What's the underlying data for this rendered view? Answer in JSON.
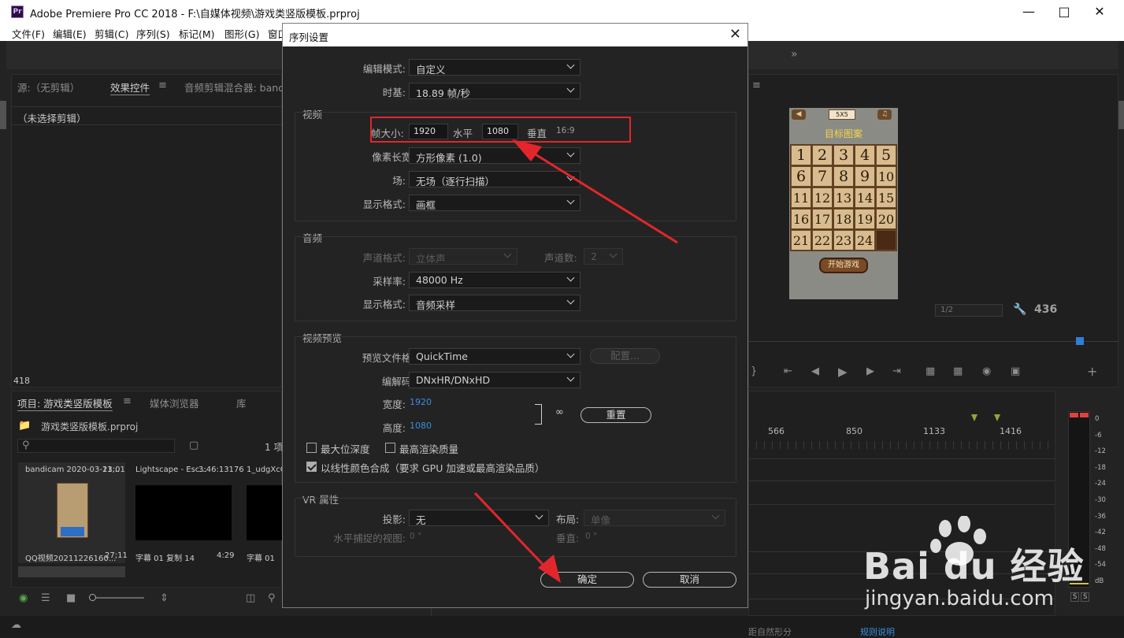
{
  "window": {
    "title": "Adobe Premiere Pro CC 2018 - F:\\自媒体视频\\游戏类竖版模板.prproj"
  },
  "menu": [
    "文件(F)",
    "编辑(E)",
    "剪辑(C)",
    "序列(S)",
    "标记(M)",
    "图形(G)",
    "窗口"
  ],
  "source_panel": {
    "tabs": [
      "源:（无剪辑）",
      "效果控件",
      "音频剪辑混合器: band"
    ],
    "empty_text": "（未选择剪辑）",
    "frame_count": "418"
  },
  "project_panel": {
    "tabs": [
      "项目: 游戏类竖版模板",
      "媒体浏览器",
      "库"
    ],
    "project_file": "游戏类竖版模板.prproj",
    "item_count": "1 项",
    "clips": [
      {
        "name": "bandicam 2020-03-11...",
        "duration": "23;01"
      },
      {
        "name": "Lightscape - Esc...",
        "duration": "3:46:13176"
      },
      {
        "name": "1_udgXcQB"
      },
      {
        "name": "QQ视频20211226160...",
        "duration": "27;11"
      },
      {
        "name": "字幕 01 复制 14",
        "duration": "4:29"
      },
      {
        "name": "字幕 01"
      }
    ]
  },
  "program_monitor": {
    "zoom": "1/2",
    "frame": "436",
    "puzzle": {
      "mode": "5X5",
      "target": "目标图案",
      "tiles": [
        "1",
        "2",
        "3",
        "4",
        "5",
        "6",
        "7",
        "8",
        "9",
        "10",
        "11",
        "12",
        "13",
        "14",
        "15",
        "16",
        "17",
        "18",
        "19",
        "20",
        "21",
        "22",
        "23",
        "24",
        ""
      ],
      "start": "开始游戏"
    }
  },
  "timeline": {
    "ruler": [
      "566",
      "850",
      "1133",
      "1416"
    ],
    "meter": [
      "0",
      "-6",
      "-12",
      "-18",
      "-24",
      "-30",
      "-36",
      "-42",
      "-48",
      "-54",
      "dB"
    ],
    "solo": [
      "S",
      "S"
    ],
    "bottom_cut_text": "距自然形分",
    "bottom_link": "规则说明"
  },
  "dialog": {
    "title": "序列设置",
    "edit_mode": {
      "label": "编辑模式:",
      "value": "自定义"
    },
    "timebase": {
      "label": "时基:",
      "value": "18.89  帧/秒"
    },
    "video": {
      "title": "视频",
      "frame_size_label": "帧大小:",
      "width": "1920",
      "h_label": "水平",
      "height": "1080",
      "v_label": "垂直",
      "ratio": "16:9",
      "pixel_aspect": {
        "label": "像素长宽比:",
        "value": "方形像素 (1.0)"
      },
      "field": {
        "label": "场:",
        "value": "无场（逐行扫描）"
      },
      "display": {
        "label": "显示格式:",
        "value": "画框"
      }
    },
    "audio": {
      "title": "音频",
      "channel_format": {
        "label": "声道格式:",
        "value": "立体声"
      },
      "channel_count": {
        "label": "声道数:",
        "value": "2"
      },
      "sample_rate": {
        "label": "采样率:",
        "value": "48000 Hz"
      },
      "display": {
        "label": "显示格式:",
        "value": "音频采样"
      }
    },
    "preview": {
      "title": "视频预览",
      "file_format": {
        "label": "预览文件格式:",
        "value": "QuickTime"
      },
      "config_label": "配置...",
      "codec": {
        "label": "编解码器:",
        "value": "DNxHR/DNxHD"
      },
      "width_label": "宽度:",
      "width_value": "1920",
      "height_label": "高度:",
      "height_value": "1080",
      "reset_label": "重置",
      "max_depth": "最大位深度",
      "max_quality": "最高渲染质量",
      "linear_color": "以线性颜色合成（要求 GPU 加速或最高渲染品质）"
    },
    "vr": {
      "title": "VR 属性",
      "projection": {
        "label": "投影:",
        "value": "无"
      },
      "layout": {
        "label": "布局:",
        "value": "单像"
      },
      "h_view_label": "水平捕捉的视图:",
      "h_view_value": "0 °",
      "v_label": "垂直:",
      "v_value": "0 °"
    },
    "ok_label": "确定",
    "cancel_label": "取消"
  },
  "watermark": {
    "brand": "Bai du 经验",
    "url": "jingyan.baidu.com"
  },
  "colors": {
    "annotation": "#e2262c",
    "accent_blue": "#3c8dde"
  }
}
